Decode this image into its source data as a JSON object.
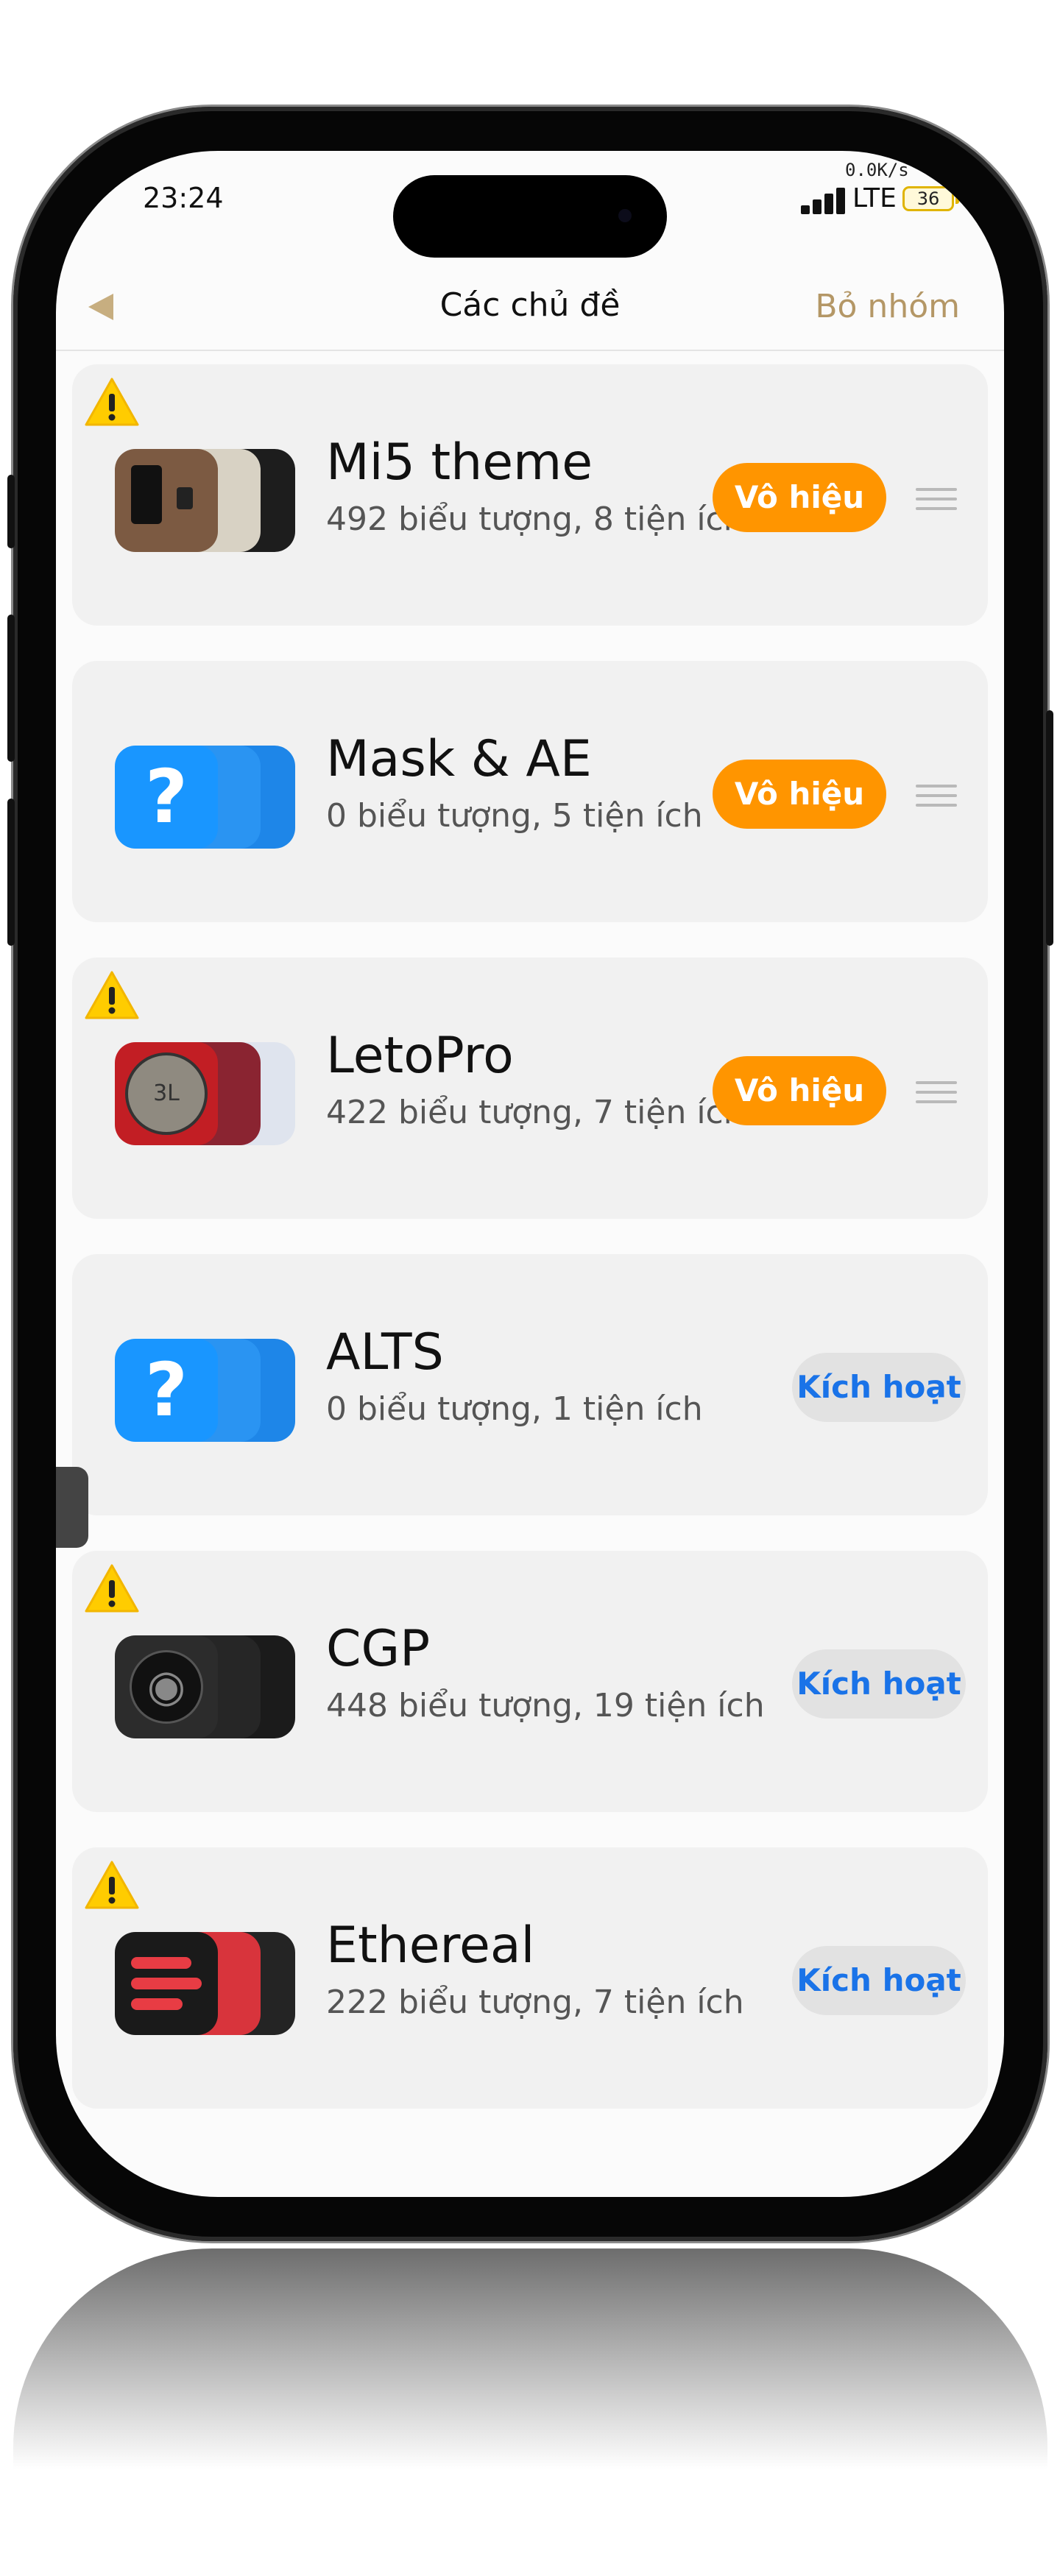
{
  "status": {
    "time": "23:24",
    "net_speed": "0.0K/s",
    "network": "LTE",
    "battery": "36"
  },
  "nav": {
    "title": "Các chủ đề",
    "right_label": "Bỏ nhóm"
  },
  "themes": [
    {
      "name": "Mi5 theme",
      "subtitle": "492 biểu tượng, 8 tiện ích",
      "action": "Vô hiệu",
      "warning": true
    },
    {
      "name": "Mask & AE",
      "subtitle": "0 biểu tượng, 5 tiện ích",
      "action": "Vô hiệu",
      "warning": false
    },
    {
      "name": "LetoPro",
      "subtitle": "422 biểu tượng, 7 tiện ích",
      "action": "Vô hiệu",
      "warning": true
    },
    {
      "name": "ALTS",
      "subtitle": "0 biểu tượng, 1 tiện ích",
      "action": "Kích hoạt",
      "warning": false
    },
    {
      "name": "CGP",
      "subtitle": "448 biểu tượng, 19 tiện ích",
      "action": "Kích hoạt",
      "warning": true
    },
    {
      "name": "Ethereal",
      "subtitle": "222 biểu tượng, 7 tiện ích",
      "action": "Kích hoạt",
      "warning": true
    }
  ],
  "icons": {
    "placeholder_glyph": "?",
    "cgp_dial_glyph": "◉",
    "leto_dial_glyph": "3L"
  },
  "colors": {
    "disable_button": "#ff9500",
    "activate_text": "#1a73e8",
    "accent": "#b49766",
    "warning": "#ffcc00"
  }
}
